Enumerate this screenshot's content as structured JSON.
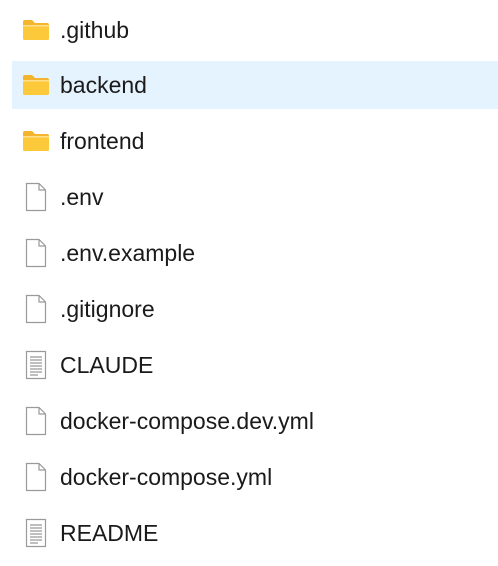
{
  "colors": {
    "selected_row": "#e5f3ff",
    "folder_body": "#fcc93a",
    "folder_tab": "#f4b42d",
    "file_outline": "#9a9a9a",
    "text": "#1a1a1a"
  },
  "items": [
    {
      "name": ".github",
      "kind": "folder",
      "icon": "folder-icon",
      "selected": false
    },
    {
      "name": "backend",
      "kind": "folder",
      "icon": "folder-icon",
      "selected": true
    },
    {
      "name": "frontend",
      "kind": "folder",
      "icon": "folder-icon",
      "selected": false
    },
    {
      "name": ".env",
      "kind": "file",
      "icon": "blank-file-icon",
      "selected": false
    },
    {
      "name": ".env.example",
      "kind": "file",
      "icon": "blank-file-icon",
      "selected": false
    },
    {
      "name": ".gitignore",
      "kind": "file",
      "icon": "blank-file-icon",
      "selected": false
    },
    {
      "name": "CLAUDE",
      "kind": "text-file",
      "icon": "text-file-icon",
      "selected": false
    },
    {
      "name": "docker-compose.dev.yml",
      "kind": "file",
      "icon": "blank-file-icon",
      "selected": false
    },
    {
      "name": "docker-compose.yml",
      "kind": "file",
      "icon": "blank-file-icon",
      "selected": false
    },
    {
      "name": "README",
      "kind": "text-file",
      "icon": "text-file-icon",
      "selected": false
    }
  ]
}
